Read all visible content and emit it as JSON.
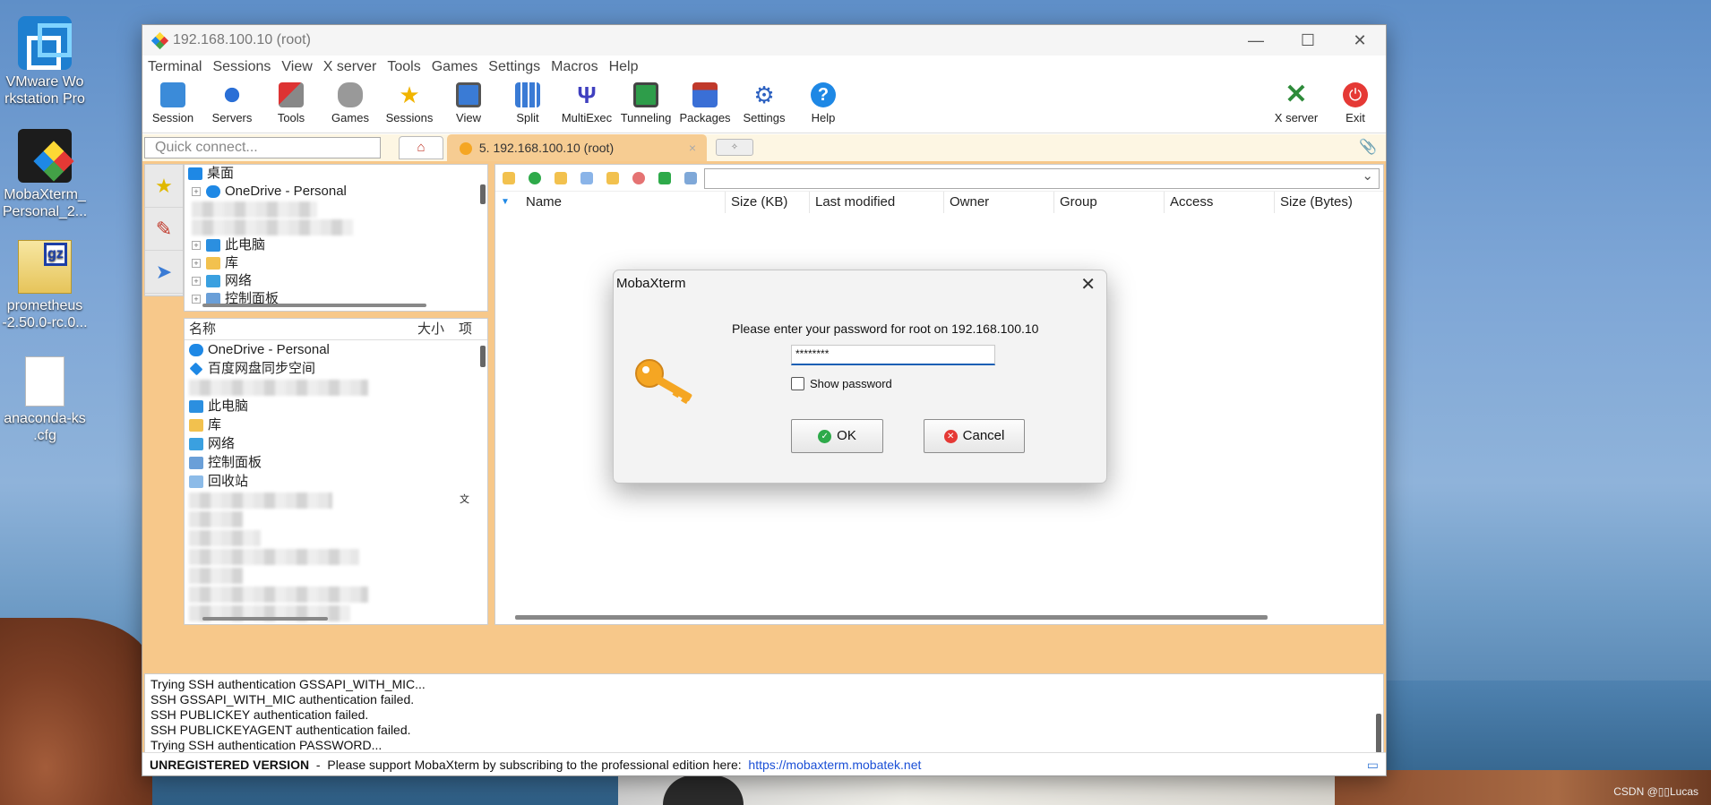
{
  "desktop": {
    "icons": [
      {
        "label": "VMware Workstation Pro",
        "line1": "VMware Wo",
        "line2": "rkstation Pro"
      },
      {
        "label": "MobaXterm_Personal_2...",
        "line1": "MobaXterm_",
        "line2": "Personal_2..."
      },
      {
        "label": "prometheus-2.50.0-rc.0...",
        "line1": "prometheus",
        "line2": "-2.50.0-rc.0..."
      },
      {
        "label": "anaconda-ks.cfg",
        "line1": "anaconda-ks",
        "line2": ".cfg"
      }
    ],
    "watermark": "CSDN @▯▯Lucas"
  },
  "window": {
    "title": "192.168.100.10 (root)",
    "controls": {
      "minimize": "—",
      "maximize": "☐",
      "close": "✕"
    }
  },
  "menu": [
    "Terminal",
    "Sessions",
    "View",
    "X server",
    "Tools",
    "Games",
    "Settings",
    "Macros",
    "Help"
  ],
  "toolbar": {
    "items": [
      "Session",
      "Servers",
      "Tools",
      "Games",
      "Sessions",
      "View",
      "Split",
      "MultiExec",
      "Tunneling",
      "Packages",
      "Settings",
      "Help"
    ],
    "right": [
      "X server",
      "Exit"
    ]
  },
  "quick_connect": {
    "placeholder": "Quick connect..."
  },
  "tabs": {
    "home": "⌂",
    "session": "5. 192.168.100.10 (root)",
    "close": "×",
    "new": "✧"
  },
  "tree": {
    "root": "桌面",
    "items": [
      "OneDrive - Personal",
      "此电脑",
      "库",
      "网络",
      "控制面板"
    ]
  },
  "file_list": {
    "headers": {
      "name": "名称",
      "size": "大小",
      "extra": "项"
    },
    "items": [
      "OneDrive - Personal",
      "百度网盘同步空间",
      "此电脑",
      "库",
      "网络",
      "控制面板",
      "回收站"
    ],
    "suffix": "文"
  },
  "sftp": {
    "columns": [
      "Name",
      "Size (KB)",
      "Last modified",
      "Owner",
      "Group",
      "Access",
      "Size (Bytes)"
    ]
  },
  "console": {
    "lines": [
      "Trying SSH authentication GSSAPI_WITH_MIC...",
      "SSH GSSAPI_WITH_MIC authentication failed.",
      "SSH PUBLICKEY authentication failed.",
      "SSH PUBLICKEYAGENT authentication failed.",
      "Trying SSH authentication PASSWORD..."
    ]
  },
  "status": {
    "unregistered": "UNREGISTERED VERSION",
    "message": "  -  Please support MobaXterm by subscribing to the professional edition here:  ",
    "link": "https://mobaxterm.mobatek.net"
  },
  "dialog": {
    "title": "MobaXterm",
    "prompt": "Please enter your password for root on 192.168.100.10",
    "password_value": "********",
    "show_password": "Show password",
    "ok": "OK",
    "cancel": "Cancel"
  }
}
